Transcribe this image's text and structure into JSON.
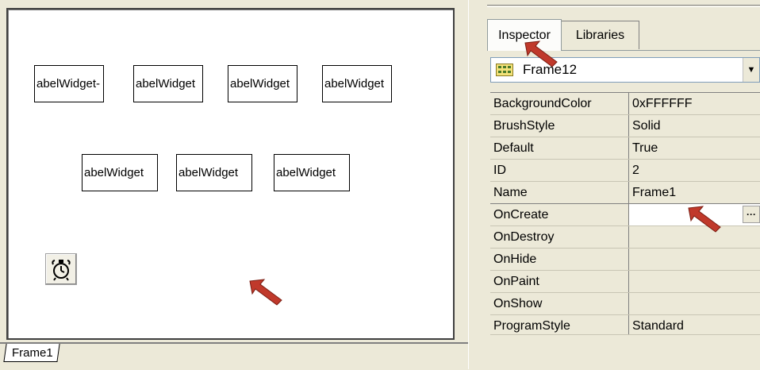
{
  "design": {
    "widgets_row1": [
      "abelWidget-",
      "abelWidget",
      "abelWidget",
      "abelWidget"
    ],
    "widgets_row2": [
      "abelWidget",
      "abelWidget",
      "abelWidget"
    ],
    "timer_icon": "timer-icon",
    "frame_tab_label": "Frame1"
  },
  "inspector": {
    "tabs": [
      {
        "label": "Inspector",
        "active": true
      },
      {
        "label": "Libraries",
        "active": false
      }
    ],
    "object_selector": {
      "icon": "frame-icon",
      "value": "Frame12"
    },
    "properties": [
      {
        "name": "BackgroundColor",
        "value": "0xFFFFFF"
      },
      {
        "name": "BrushStyle",
        "value": "Solid"
      },
      {
        "name": "Default",
        "value": "True"
      },
      {
        "name": "ID",
        "value": "2"
      },
      {
        "name": "Name",
        "value": "Frame1"
      }
    ],
    "events": [
      {
        "name": "OnCreate",
        "value": ""
      },
      {
        "name": "OnDestroy",
        "value": ""
      },
      {
        "name": "OnHide",
        "value": ""
      },
      {
        "name": "OnPaint",
        "value": ""
      },
      {
        "name": "OnShow",
        "value": ""
      },
      {
        "name": "ProgramStyle",
        "value": "Standard"
      }
    ],
    "ellipsis_label": "···"
  },
  "colors": {
    "panel_bg": "#ece9d8",
    "arrow_red": "#c0392b"
  }
}
